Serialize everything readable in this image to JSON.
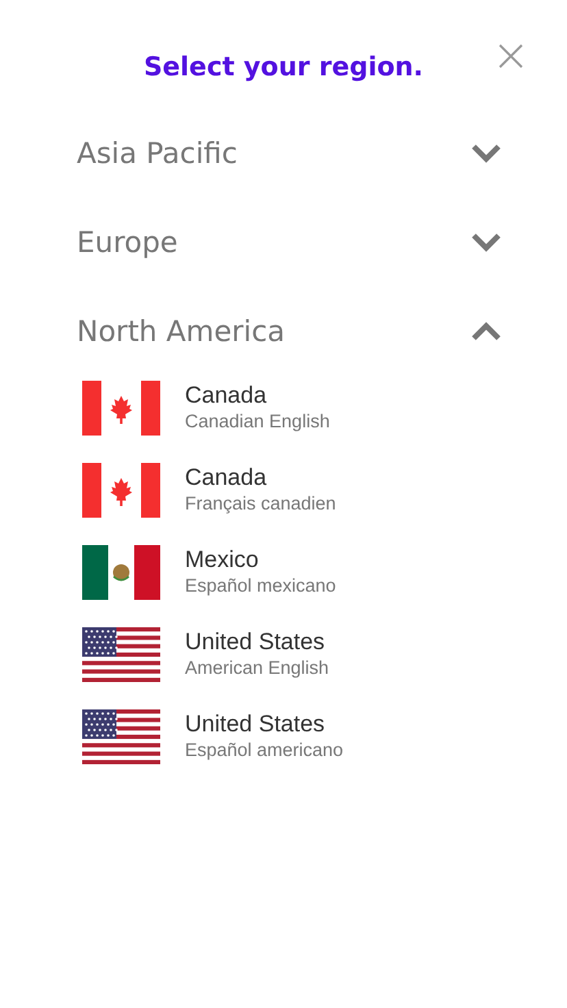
{
  "title": "Select your region.",
  "regions": [
    {
      "name": "Asia Pacific",
      "expanded": false
    },
    {
      "name": "Europe",
      "expanded": false
    },
    {
      "name": "North America",
      "expanded": true,
      "children": [
        {
          "kind": "ca",
          "country": "Canada",
          "language": "Canadian English"
        },
        {
          "kind": "ca",
          "country": "Canada",
          "language": "Français canadien"
        },
        {
          "kind": "mx",
          "country": "Mexico",
          "language": "Español mexicano"
        },
        {
          "kind": "us",
          "country": "United States",
          "language": "American English"
        },
        {
          "kind": "us",
          "country": "United States",
          "language": "Español americano"
        }
      ]
    }
  ]
}
